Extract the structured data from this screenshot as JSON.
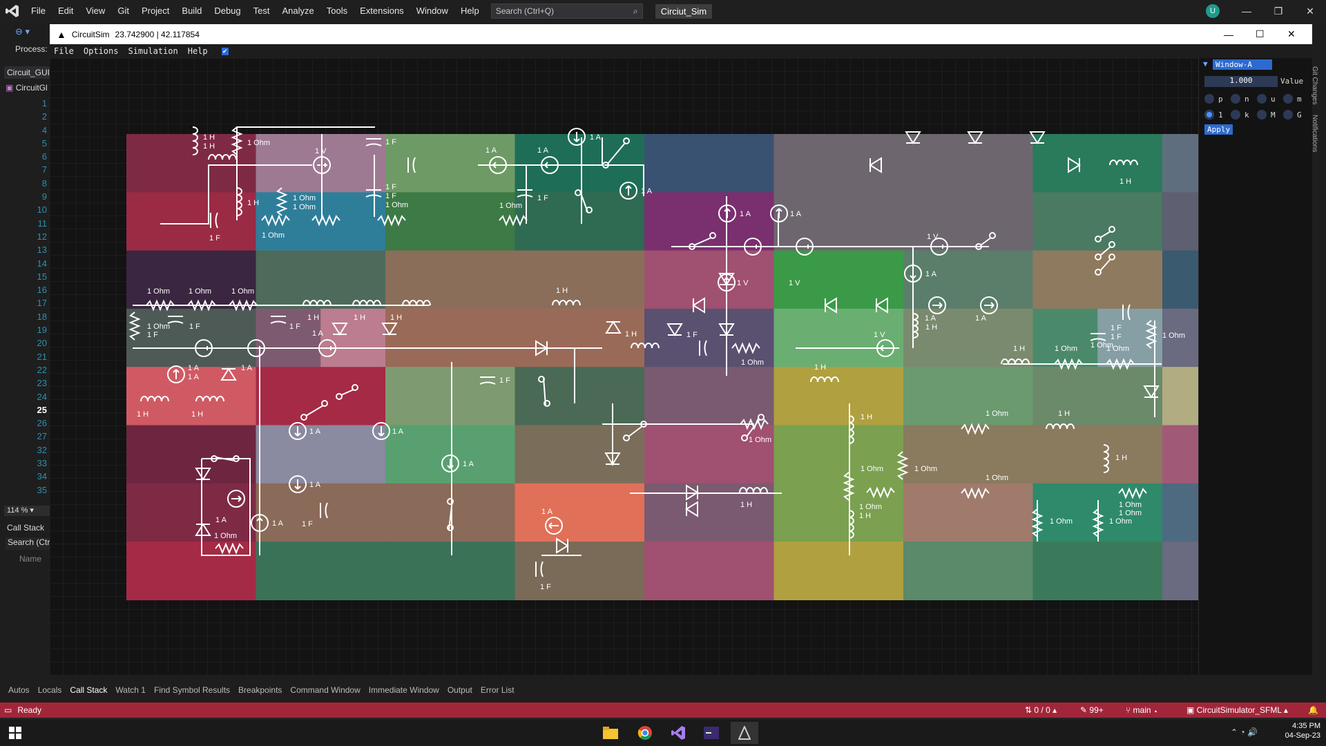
{
  "vs": {
    "menu": [
      "File",
      "Edit",
      "View",
      "Git",
      "Project",
      "Build",
      "Debug",
      "Test",
      "Analyze",
      "Tools",
      "Extensions",
      "Window",
      "Help"
    ],
    "search_placeholder": "Search (Ctrl+Q)",
    "project": "Circiut_Sim",
    "avatar": "U",
    "process_label": "Process:",
    "solution_tab": "Circuit_GUI",
    "file_tab": "CircuitGl",
    "line_numbers": [
      "1",
      "2",
      "4",
      "5",
      "6",
      "7",
      "8",
      "9",
      "10",
      "11",
      "12",
      "13",
      "14",
      "15",
      "16",
      "17",
      "18",
      "19",
      "20",
      "21",
      "22",
      "23",
      "24",
      "25",
      "26",
      "27",
      "32",
      "33",
      "34",
      "35"
    ],
    "current_line": "25",
    "zoom": "114 %",
    "callstack_title": "Call Stack",
    "callstack_search": "Search (Ctrl",
    "callstack_col": "Name",
    "side_tabs": [
      "Git Changes",
      "Notifications"
    ],
    "bottom_tabs": [
      "Autos",
      "Locals",
      "Call Stack",
      "Watch 1",
      "Find Symbol Results",
      "Breakpoints",
      "Command Window",
      "Immediate Window",
      "Output",
      "Error List"
    ],
    "active_bottom_tab": "Call Stack",
    "status": {
      "ready": "Ready",
      "lines": "0 / 0",
      "edits": "99+",
      "branch": "main",
      "repo": "CircuitSimulator_SFML"
    }
  },
  "circuitsim": {
    "title": "CircuitSim",
    "coords": "23.742900 | 42.117854",
    "menu": [
      "File",
      "Options",
      "Simulation",
      "Help"
    ],
    "checkmark": "✔",
    "panel": {
      "window_title": "Window-A",
      "value": "1.000",
      "value_label": "Value",
      "prefixes": [
        "p",
        "n",
        "u",
        "m",
        "1",
        "k",
        "M",
        "G"
      ],
      "selected_prefix": "1",
      "apply": "Apply"
    }
  },
  "schematic": {
    "labels": {
      "ohm": "1 Ohm",
      "henry": "1 H",
      "farad": "1 F",
      "volt": "1 V",
      "amp": "1 A"
    },
    "grid_colors": [
      [
        "#7e2a45",
        "#9e7a92",
        "#6e9a66",
        "#1e6e57",
        "#3a5272",
        "#6d666f",
        "#6d666f",
        "#2a7a5c",
        "#5f6e7e"
      ],
      [
        "#9b2a45",
        "#2e7e9a",
        "#3d7a45",
        "#2f6a52",
        "#7a2f6e",
        "#6d666f",
        "#6d666f",
        "#4a7a62",
        "#5f5f72"
      ],
      [
        "#3a2640",
        "#4e6a5a",
        "#8a6e5a",
        "#8a6e5a",
        "#a05070",
        "#3a9a48",
        "#5a7e6a",
        "#8e7a5e",
        "#3a5a70"
      ],
      [
        "#4d5a55",
        "#7e5a70",
        "#9a6a58",
        "#9a6a58",
        "#5a5070",
        "#6aae72",
        "#7a8a6e",
        "#4a8a6a",
        "#6a6a80"
      ],
      [
        "#d05a64",
        "#a52a45",
        "#7e9a70",
        "#4a6a55",
        "#7a5a70",
        "#b0a040",
        "#6a9a6e",
        "#6a8a6a",
        "#a06e72"
      ],
      [
        "#6e2640",
        "#8a8aa0",
        "#58a070",
        "#7a6e5a",
        "#a05070",
        "#7aa050",
        "#8a7a5e",
        "#8a7a5e",
        "#a05a78"
      ],
      [
        "#7e2a45",
        "#8a6a58",
        "#8a6a58",
        "#e07058",
        "#7a5a70",
        "#7aa050",
        "#a07a6a",
        "#2e8a6a",
        "#4e6a80"
      ],
      [
        "#a52a45",
        "#3a7258",
        "#3a7258",
        "#7a6a58",
        "#a05070",
        "#b0a040",
        "#5a8a6a",
        "#3a7a5a",
        "#6a6a80"
      ]
    ],
    "highlight_cells": [
      {
        "col": 1.5,
        "row": 3.0,
        "color": "#d08a9a"
      },
      {
        "col": 7.5,
        "row": 3.0,
        "color": "#9aa6ba"
      },
      {
        "col": 8.0,
        "row": 4.0,
        "color": "#b8c28a"
      }
    ]
  },
  "taskbar": {
    "time": "4:35 PM",
    "date": "04-Sep-23"
  }
}
